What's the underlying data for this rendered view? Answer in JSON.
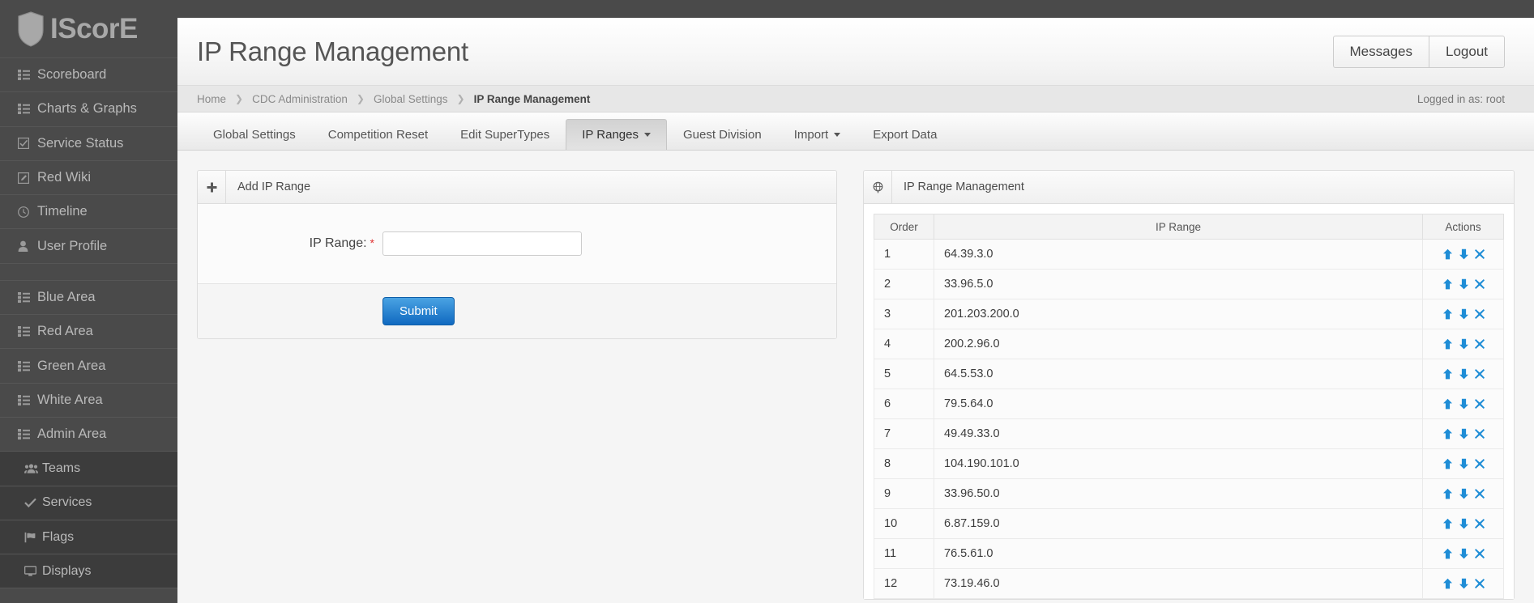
{
  "brand": {
    "name": "IScorE",
    "icon": "shield-icon"
  },
  "sidebar": {
    "items": [
      {
        "label": "Scoreboard",
        "icon": "list-icon",
        "sub": false
      },
      {
        "label": "Charts & Graphs",
        "icon": "list-icon",
        "sub": false
      },
      {
        "label": "Service Status",
        "icon": "check-square-icon",
        "sub": false
      },
      {
        "label": "Red Wiki",
        "icon": "edit-square-icon",
        "sub": false
      },
      {
        "label": "Timeline",
        "icon": "clock-icon",
        "sub": false
      },
      {
        "label": "User Profile",
        "icon": "user-icon",
        "sub": false
      },
      {
        "label": "Blue Area",
        "icon": "list-icon",
        "sub": false
      },
      {
        "label": "Red Area",
        "icon": "list-icon",
        "sub": false
      },
      {
        "label": "Green Area",
        "icon": "list-icon",
        "sub": false
      },
      {
        "label": "White Area",
        "icon": "list-icon",
        "sub": false
      },
      {
        "label": "Admin Area",
        "icon": "list-icon",
        "sub": false
      },
      {
        "label": "Teams",
        "icon": "users-icon",
        "sub": true
      },
      {
        "label": "Services",
        "icon": "check-icon",
        "sub": true
      },
      {
        "label": "Flags",
        "icon": "flag-icon",
        "sub": true
      },
      {
        "label": "Displays",
        "icon": "desktop-icon",
        "sub": true
      }
    ]
  },
  "header": {
    "title": "IP Range Management",
    "messages_label": "Messages",
    "logout_label": "Logout",
    "logged_in_as": "Logged in as: root"
  },
  "breadcrumb": {
    "items": [
      "Home",
      "CDC Administration",
      "Global Settings"
    ],
    "current": "IP Range Management",
    "separator": "❯"
  },
  "tabs": [
    {
      "label": "Global Settings",
      "active": false,
      "dropdown": false
    },
    {
      "label": "Competition Reset",
      "active": false,
      "dropdown": false
    },
    {
      "label": "Edit SuperTypes",
      "active": false,
      "dropdown": false
    },
    {
      "label": "IP Ranges",
      "active": true,
      "dropdown": true
    },
    {
      "label": "Guest Division",
      "active": false,
      "dropdown": false
    },
    {
      "label": "Import",
      "active": false,
      "dropdown": true
    },
    {
      "label": "Export Data",
      "active": false,
      "dropdown": false
    }
  ],
  "add_panel": {
    "icon": "plus-icon",
    "title": "Add IP Range",
    "field_label": "IP Range:",
    "required_mark": "*",
    "field_value": "",
    "field_placeholder": "",
    "submit_label": "Submit"
  },
  "list_panel": {
    "icon": "globe-icon",
    "title": "IP Range Management",
    "columns": [
      "Order",
      "IP Range",
      "Actions"
    ],
    "action_icons": [
      "arrow-up-icon",
      "arrow-down-icon",
      "delete-x-icon"
    ],
    "rows": [
      {
        "order": "1",
        "range": "64.39.3.0"
      },
      {
        "order": "2",
        "range": "33.96.5.0"
      },
      {
        "order": "3",
        "range": "201.203.200.0"
      },
      {
        "order": "4",
        "range": "200.2.96.0"
      },
      {
        "order": "5",
        "range": "64.5.53.0"
      },
      {
        "order": "6",
        "range": "79.5.64.0"
      },
      {
        "order": "7",
        "range": "49.49.33.0"
      },
      {
        "order": "8",
        "range": "104.190.101.0"
      },
      {
        "order": "9",
        "range": "33.96.50.0"
      },
      {
        "order": "10",
        "range": "6.87.159.0"
      },
      {
        "order": "11",
        "range": "76.5.61.0"
      },
      {
        "order": "12",
        "range": "73.19.46.0"
      }
    ]
  },
  "colors": {
    "sidebar_bg": "#4a4a4a",
    "sidebar_sub_bg": "#3c3c3c",
    "action_blue": "#1f8dd6",
    "submit_blue": "#1069c0",
    "required_red": "#e03131"
  }
}
